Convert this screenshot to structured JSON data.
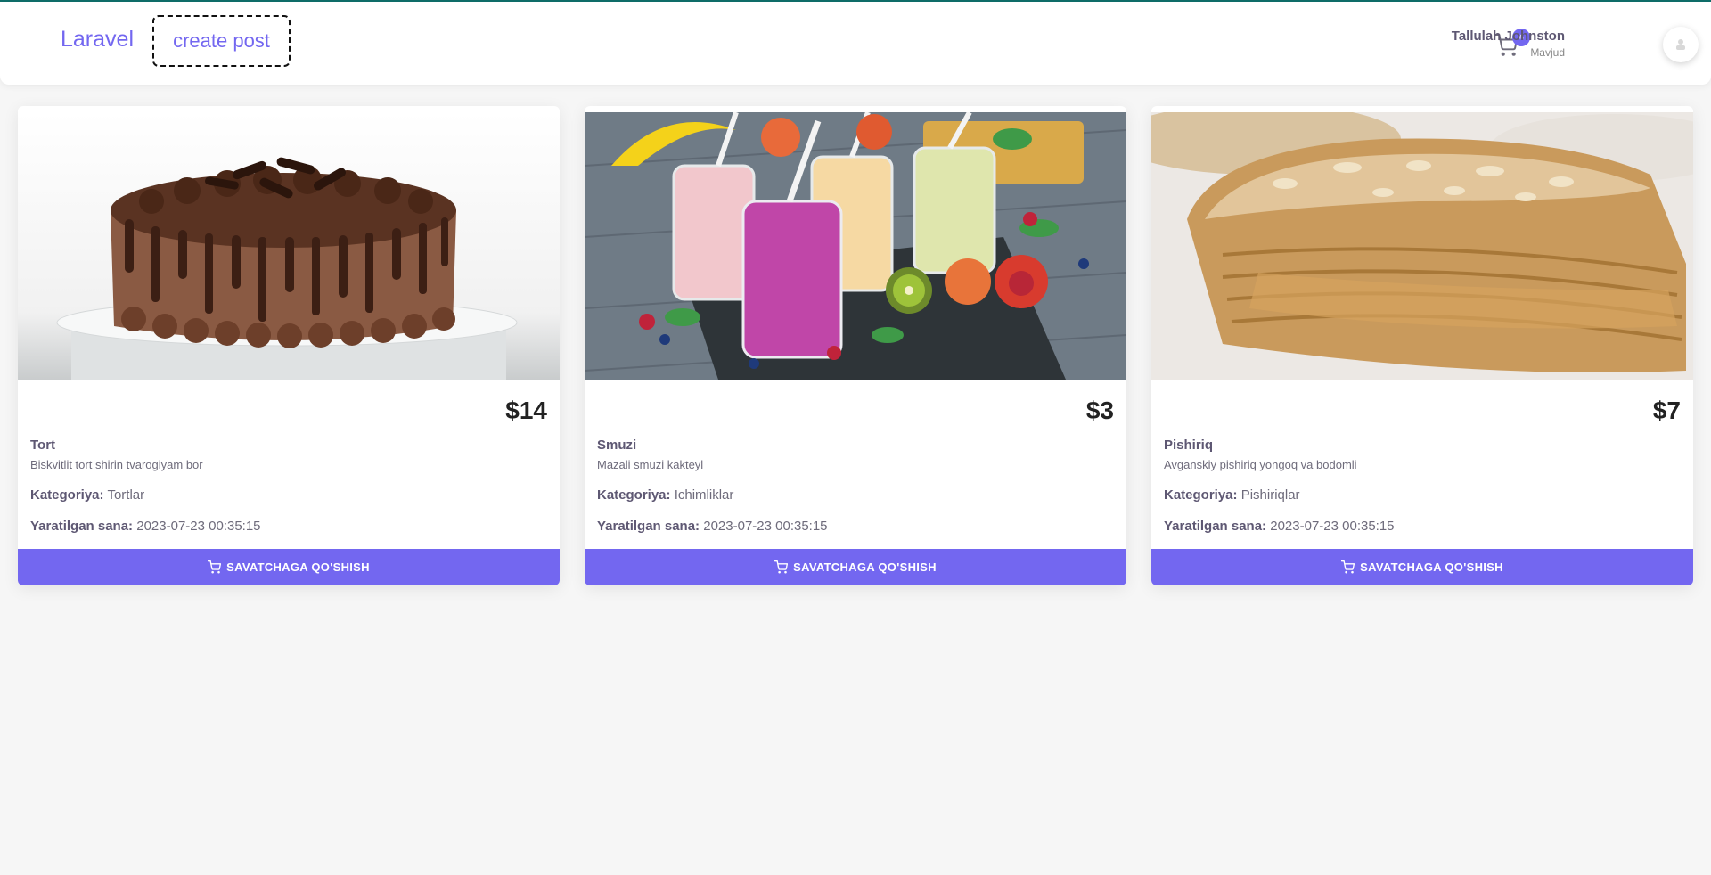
{
  "navbar": {
    "brand": "Laravel",
    "create_post": "create post",
    "cart_count": "4",
    "user_name": "Tallulah Johnston",
    "user_status": "Mavjud"
  },
  "colors": {
    "accent": "#7367f0",
    "top_line": "#0f6e6a",
    "background": "#f6f6f6"
  },
  "products": [
    {
      "price": "$14",
      "name": "Tort",
      "description": "Biskvitlit tort shirin tvarogiyam bor",
      "category_label": "Kategoriya:",
      "category": "Tortlar",
      "created_label": "Yaratilgan sana:",
      "created": "2023-07-23 00:35:15",
      "button": "SAVATCHAGA QO'SHISH",
      "image": "chocolate-cake-photo"
    },
    {
      "price": "$3",
      "name": "Smuzi",
      "description": "Mazali smuzi kakteyl",
      "category_label": "Kategoriya:",
      "category": "Ichimliklar",
      "created_label": "Yaratilgan sana:",
      "created": "2023-07-23 00:35:15",
      "button": "SAVATCHAGA QO'SHISH",
      "image": "smoothies-photo"
    },
    {
      "price": "$7",
      "name": "Pishiriq",
      "description": "Avganskiy pishiriq yongoq va bodomli",
      "category_label": "Kategoriya:",
      "category": "Pishiriqlar",
      "created_label": "Yaratilgan sana:",
      "created": "2023-07-23 00:35:15",
      "button": "SAVATCHAGA QO'SHISH",
      "image": "layered-pastry-photo"
    }
  ]
}
